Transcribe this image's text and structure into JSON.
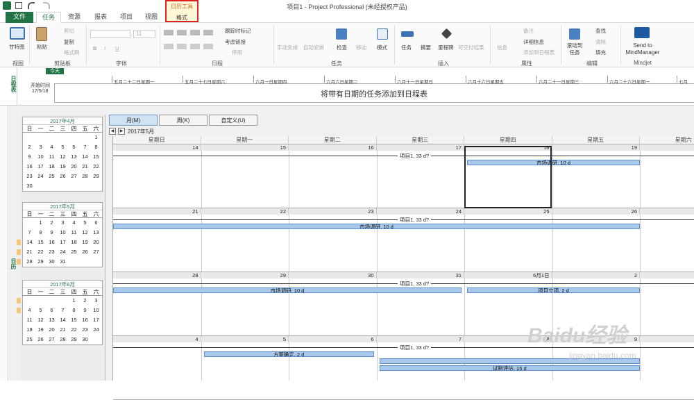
{
  "title": "项目1 - Project Professional (未经授权产品)",
  "calendar_tools": {
    "top": "日历工具",
    "bottom": "格式"
  },
  "tabs": [
    "文件",
    "任务",
    "资源",
    "报表",
    "项目",
    "视图"
  ],
  "ribbon": {
    "groups": [
      "视图",
      "剪贴板",
      "字体",
      "日程",
      "任务",
      "插入",
      "属性",
      "编辑",
      "Mindjet"
    ],
    "gantt": "甘特图",
    "paste": "粘贴",
    "cut": "剪切",
    "copy": "复制",
    "format_painter": "格式刷",
    "font_size": "11",
    "bold": "B",
    "italic": "I",
    "underline": "U",
    "mark_on_track": "跟踪时标记",
    "respect_links": "考虑链接",
    "deactivate": "停用",
    "manual": "手动安排",
    "auto": "自动安排",
    "inspect": "检查",
    "move": "移动",
    "mode": "模式",
    "task": "任务",
    "summary": "摘要",
    "milestone": "里程碑",
    "deliverable": "可交付结果",
    "info": "信息",
    "notes": "备注",
    "details": "详细信息",
    "add_timeline": "添加到日程表",
    "scroll_to_task": "滚动到任务",
    "find": "查找",
    "clear": "清除",
    "fill": "填充",
    "send_mm": "Send to MindManager"
  },
  "timeline": {
    "side_label": "日程表",
    "today": "今天",
    "start_label": "开始时间",
    "start_date": "17/5/18",
    "dates": [
      "五月二十二日星期一",
      "五月二十七日星期六",
      "六月一日星期四",
      "六月六日星期二",
      "六月十一日星期日",
      "六月十六日星期五",
      "六月二十一日星期三",
      "六月二十六日星期一",
      "七月"
    ],
    "placeholder": "将带有日期的任务添加到日程表"
  },
  "cal_side_label": "日历",
  "view_buttons": [
    "月(M)",
    "周(K)",
    "自定义(U)"
  ],
  "current_month": "2017年5月",
  "weekday_headers": [
    "星期日",
    "星期一",
    "星期二",
    "星期三",
    "星期四",
    "星期五",
    "星期六"
  ],
  "mini_cals": [
    {
      "title": "2017年4月",
      "weekdays": [
        "日",
        "一",
        "二",
        "三",
        "四",
        "五",
        "六"
      ],
      "weeks": [
        [
          "",
          "",
          "",
          "",
          "",
          "",
          "1"
        ],
        [
          "2",
          "3",
          "4",
          "5",
          "6",
          "7",
          "8"
        ],
        [
          "9",
          "10",
          "11",
          "12",
          "13",
          "14",
          "15"
        ],
        [
          "16",
          "17",
          "18",
          "19",
          "20",
          "21",
          "22"
        ],
        [
          "23",
          "24",
          "25",
          "26",
          "27",
          "28",
          "29"
        ],
        [
          "30",
          "",
          "",
          "",
          "",
          "",
          ""
        ]
      ],
      "marks": []
    },
    {
      "title": "2017年5月",
      "weekdays": [
        "日",
        "一",
        "二",
        "三",
        "四",
        "五",
        "六"
      ],
      "weeks": [
        [
          "",
          "1",
          "2",
          "3",
          "4",
          "5",
          "6"
        ],
        [
          "7",
          "8",
          "9",
          "10",
          "11",
          "12",
          "13"
        ],
        [
          "14",
          "15",
          "16",
          "17",
          "18",
          "19",
          "20"
        ],
        [
          "21",
          "22",
          "23",
          "24",
          "25",
          "26",
          "27"
        ],
        [
          "28",
          "29",
          "30",
          "31",
          "",
          "",
          ""
        ]
      ],
      "marks": [
        2,
        3,
        4
      ]
    },
    {
      "title": "2017年6月",
      "weekdays": [
        "日",
        "一",
        "二",
        "三",
        "四",
        "五",
        "六"
      ],
      "weeks": [
        [
          "",
          "",
          "",
          "",
          "1",
          "2",
          "3"
        ],
        [
          "4",
          "5",
          "6",
          "7",
          "8",
          "9",
          "10"
        ],
        [
          "11",
          "12",
          "13",
          "14",
          "15",
          "16",
          "17"
        ],
        [
          "18",
          "19",
          "20",
          "21",
          "22",
          "23",
          "24"
        ],
        [
          "25",
          "26",
          "27",
          "28",
          "29",
          "30",
          ""
        ]
      ],
      "marks": [
        0,
        1
      ]
    }
  ],
  "weeks": [
    {
      "days": [
        "14",
        "15",
        "16",
        "17",
        "18",
        "19"
      ],
      "summary": "项目1, 33 d?",
      "bars": [
        {
          "label": "市场调研, 10 d",
          "start": 4,
          "end": 6
        }
      ]
    },
    {
      "days": [
        "21",
        "22",
        "23",
        "24",
        "25",
        "26"
      ],
      "summary": "项目1, 33 d?",
      "bars": [
        {
          "label": "市场调研, 10 d",
          "start": 0,
          "end": 6
        }
      ]
    },
    {
      "days": [
        "28",
        "29",
        "30",
        "31",
        "6月1日",
        "2"
      ],
      "summary": "项目1, 33 d?",
      "bars": [
        {
          "label": "市场调研, 10 d",
          "start": 0,
          "end": 4
        },
        {
          "label": "项目立项, 2 d",
          "start": 4,
          "end": 6
        }
      ]
    },
    {
      "days": [
        "4",
        "5",
        "6",
        "7",
        "8",
        "9"
      ],
      "summary": "项目1, 33 d?",
      "bars": [
        {
          "label": "方案确定, 2 d",
          "start": 1,
          "end": 3
        },
        {
          "label": "",
          "start": 3,
          "end": 6
        },
        {
          "label": "试制评估, 15 d",
          "start": 3,
          "end": 6
        }
      ]
    }
  ],
  "watermark": "Baidu经验",
  "watermark_url": "jingyan.baidu.com"
}
